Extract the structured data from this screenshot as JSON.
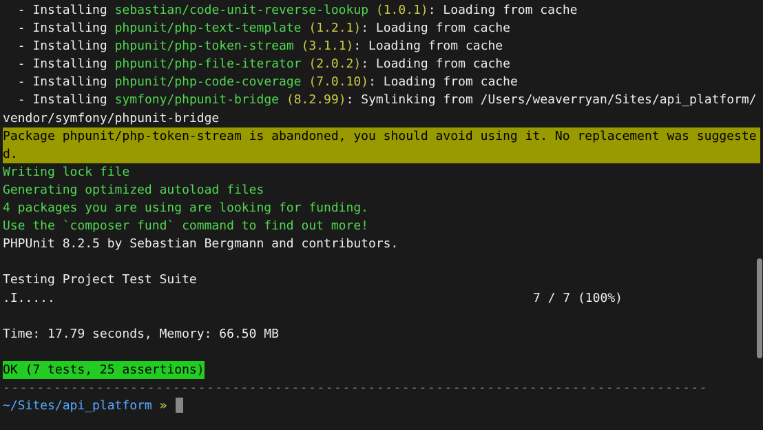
{
  "installs": [
    {
      "dash": "  - ",
      "action": "Installing ",
      "pkg": "sebastian/code-unit-reverse-lookup",
      "version": " (1.0.1)",
      "after": ": Loading from cache"
    },
    {
      "dash": "  - ",
      "action": "Installing ",
      "pkg": "phpunit/php-text-template",
      "version": " (1.2.1)",
      "after": ": Loading from cache"
    },
    {
      "dash": "  - ",
      "action": "Installing ",
      "pkg": "phpunit/php-token-stream",
      "version": " (3.1.1)",
      "after": ": Loading from cache"
    },
    {
      "dash": "  - ",
      "action": "Installing ",
      "pkg": "phpunit/php-file-iterator",
      "version": " (2.0.2)",
      "after": ": Loading from cache"
    },
    {
      "dash": "  - ",
      "action": "Installing ",
      "pkg": "phpunit/php-code-coverage",
      "version": " (7.0.10)",
      "after": ": Loading from cache"
    },
    {
      "dash": "  - ",
      "action": "Installing ",
      "pkg": "symfony/phpunit-bridge",
      "version": " (8.2.99)",
      "after": ": Symlinking from /Users/weaverryan/Sites/api_platform/vendor/symfony/phpunit-bridge"
    }
  ],
  "warning_text": "Package phpunit/php-token-stream is abandoned, you should avoid using it. No replacement was suggested.",
  "green_lines": {
    "a": "Writing lock file",
    "b": "Generating optimized autoload files",
    "c": "4 packages you are using are looking for funding.",
    "d": "Use the `composer fund` command to find out more!"
  },
  "phpunit_header": "PHPUnit 8.2.5 by Sebastian Bergmann and contributors.",
  "testing_label": "Testing Project Test Suite",
  "progress": {
    "dots": ".I.....",
    "count_text": "7 / 7 (100%)"
  },
  "time_line": "Time: 17.79 seconds, Memory: 66.50 MB",
  "ok_text": "OK (7 tests, 25 assertions)",
  "separator": "-----------------------------------------------------------------------------------",
  "prompt": {
    "path": "~/Sites/api_platform",
    "arrow": " » "
  }
}
